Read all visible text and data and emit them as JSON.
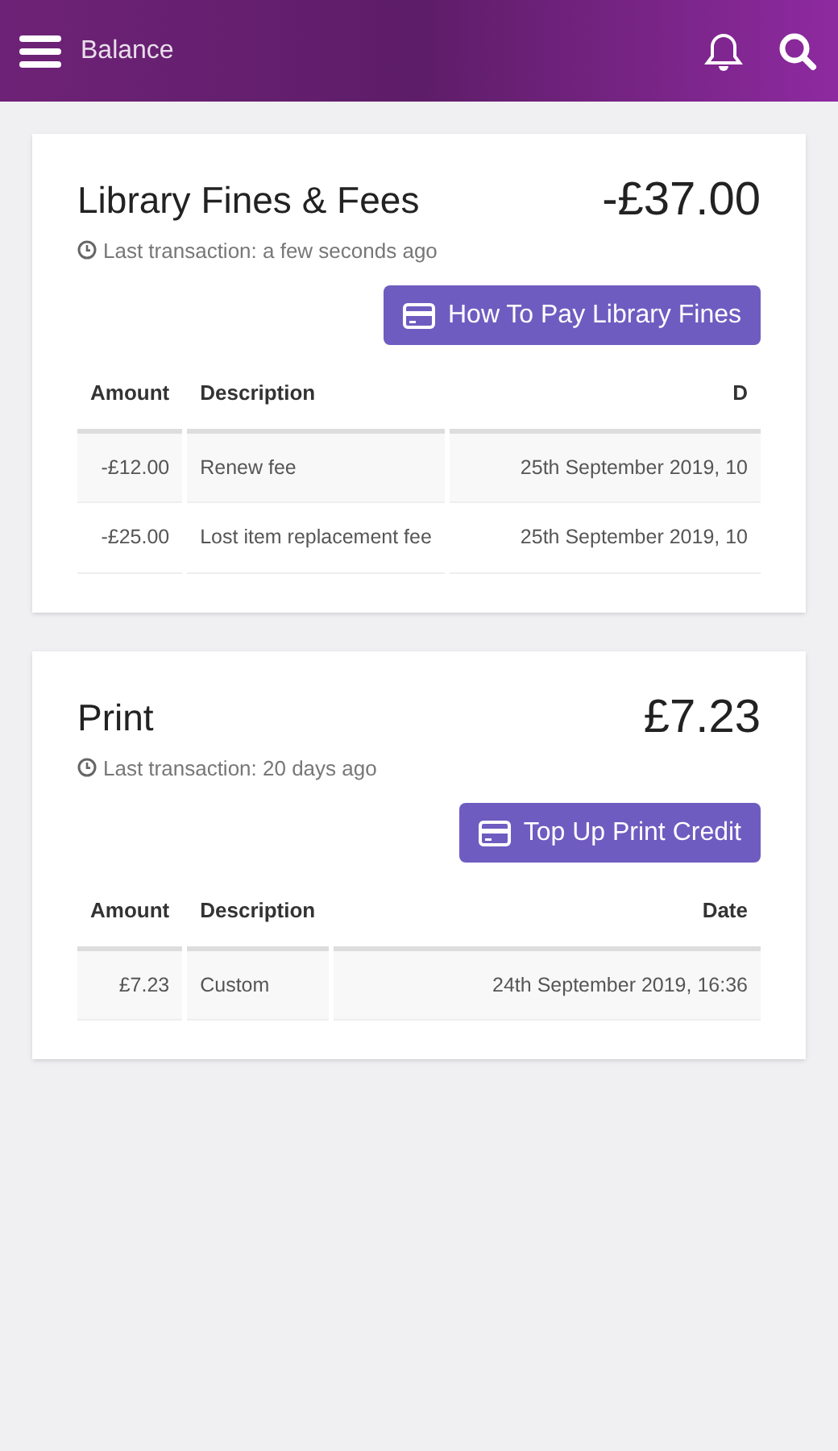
{
  "header": {
    "title": "Balance"
  },
  "cards": [
    {
      "title": "Library Fines & Fees",
      "total": "-£37.00",
      "last_transaction": "Last transaction: a few seconds ago",
      "button": "How To Pay Library Fines",
      "columns": [
        "Amount",
        "Description",
        "D"
      ],
      "rows": [
        {
          "amount": "-£12.00",
          "description": "Renew fee",
          "date": "25th September 2019, 10"
        },
        {
          "amount": "-£25.00",
          "description": "Lost item replacement fee",
          "date": "25th September 2019, 10"
        }
      ]
    },
    {
      "title": "Print",
      "total": "£7.23",
      "last_transaction": "Last transaction: 20 days ago",
      "button": "Top Up Print Credit",
      "columns": [
        "Amount",
        "Description",
        "Date"
      ],
      "rows": [
        {
          "amount": "£7.23",
          "description": "Custom",
          "date": "24th September 2019, 16:36"
        }
      ]
    }
  ]
}
